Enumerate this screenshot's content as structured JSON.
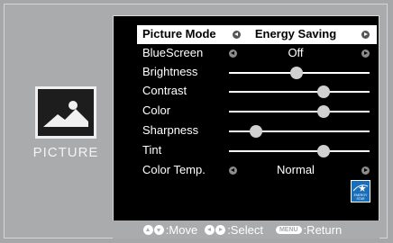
{
  "category": {
    "label": "PICTURE",
    "icon": "picture-icon"
  },
  "menu": {
    "rows": [
      {
        "label": "Picture Mode",
        "type": "select",
        "value": "Energy Saving",
        "selected": true
      },
      {
        "label": "BlueScreen",
        "type": "select",
        "value": "Off"
      },
      {
        "label": "Brightness",
        "type": "slider",
        "level": 0.48
      },
      {
        "label": "Contrast",
        "type": "slider",
        "level": 0.67
      },
      {
        "label": "Color",
        "type": "slider",
        "level": 0.67
      },
      {
        "label": "Sharpness",
        "type": "slider",
        "level": 0.19
      },
      {
        "label": "Tint",
        "type": "slider",
        "level": 0.67
      },
      {
        "label": "Color Temp.",
        "type": "select",
        "value": "Normal"
      }
    ]
  },
  "badge": {
    "icon": "energy-star-icon",
    "text": "ENERGY STAR"
  },
  "footer": {
    "move": ":Move",
    "select": ":Select",
    "menu_key": "MENU",
    "return": ":Return"
  },
  "colors": {
    "background": "#a9abad",
    "menu_background": "#000000",
    "selected_row": "#ffffff",
    "energy_star_blue": "#1a6fb8"
  }
}
